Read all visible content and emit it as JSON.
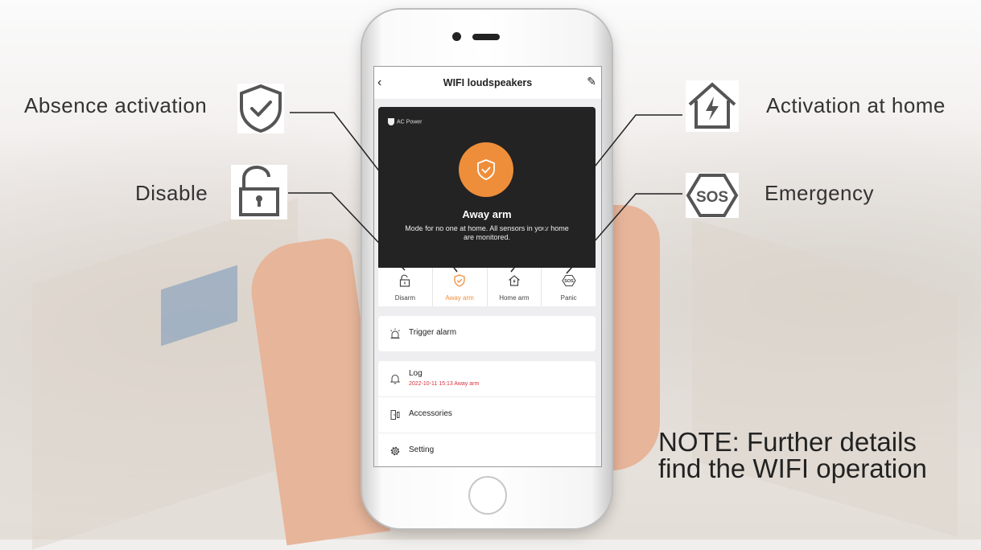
{
  "callouts": {
    "absence": "Absence activation",
    "disable": "Disable",
    "home": "Activation at home",
    "emergency": "Emergency"
  },
  "note": {
    "line1": "NOTE: Further details",
    "line2": "find the WIFI operation"
  },
  "app": {
    "title": "WIFI loudspeakers",
    "power_label": "AC Power",
    "status_title": "Away arm",
    "status_desc": "Mode for no one at home. All sensors in your home are monitored.",
    "modes": [
      {
        "label": "Disarm",
        "icon": "unlock-icon"
      },
      {
        "label": "Away arm",
        "icon": "shield-check-icon",
        "active": true
      },
      {
        "label": "Home arm",
        "icon": "house-bolt-icon"
      },
      {
        "label": "Panic",
        "icon": "sos-icon"
      }
    ],
    "trigger": "Trigger alarm",
    "log": {
      "label": "Log",
      "entry": "2022-10-11 15:13 Away arm"
    },
    "accessories": "Accessories",
    "setting": "Setting"
  },
  "colors": {
    "accent": "#ef8e3a",
    "log_red": "#d4323e",
    "hero_bg": "#232323"
  }
}
